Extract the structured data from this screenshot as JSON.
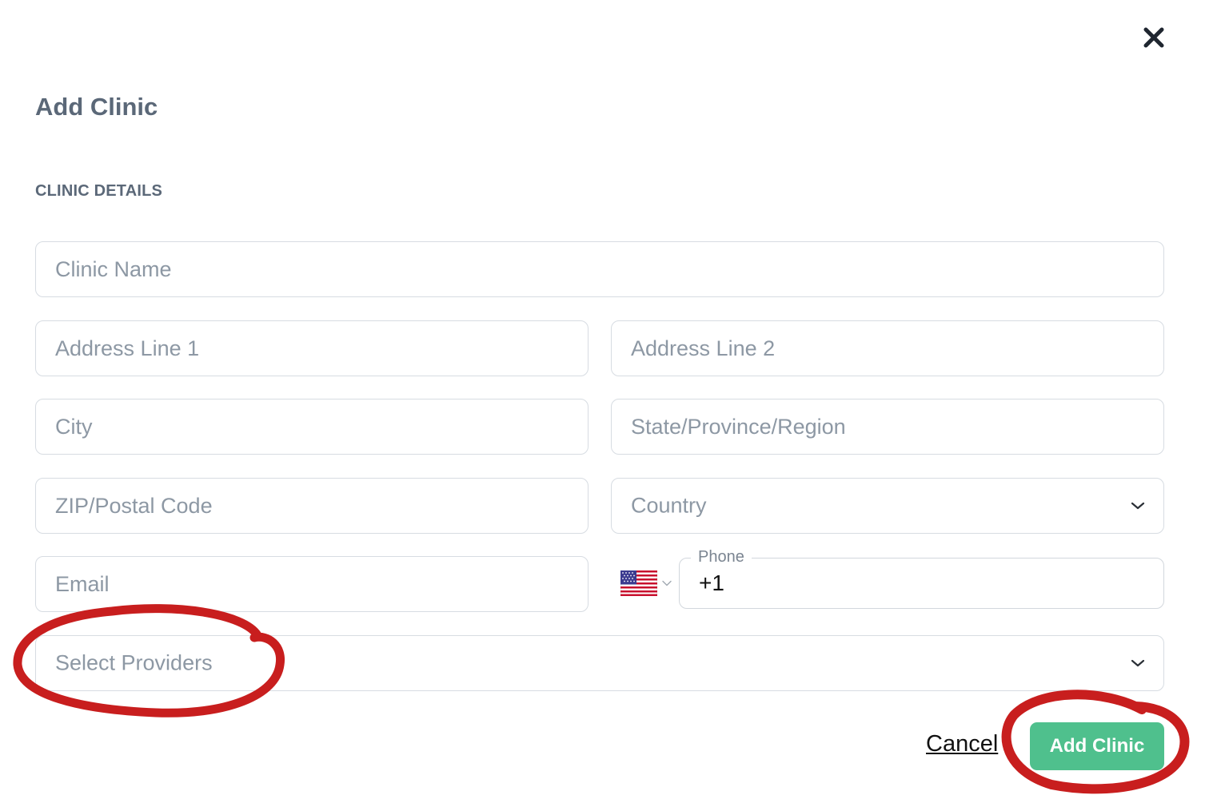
{
  "dialog": {
    "title": "Add Clinic",
    "section_label": "CLINIC DETAILS"
  },
  "form": {
    "clinic_name": {
      "placeholder": "Clinic Name",
      "value": ""
    },
    "address_line_1": {
      "placeholder": "Address Line 1",
      "value": ""
    },
    "address_line_2": {
      "placeholder": "Address Line 2",
      "value": ""
    },
    "city": {
      "placeholder": "City",
      "value": ""
    },
    "state": {
      "placeholder": "State/Province/Region",
      "value": ""
    },
    "zip": {
      "placeholder": "ZIP/Postal Code",
      "value": ""
    },
    "country": {
      "placeholder": "Country",
      "selected": ""
    },
    "email": {
      "placeholder": "Email",
      "value": ""
    },
    "phone": {
      "label": "Phone",
      "value": "+1",
      "country_flag": "us-flag-icon"
    },
    "providers": {
      "placeholder": "Select Providers"
    }
  },
  "actions": {
    "cancel_label": "Cancel",
    "submit_label": "Add Clinic"
  },
  "colors": {
    "primary_button": "#4fc08d",
    "heading_text": "#5b6878",
    "placeholder_text": "#8d98a4",
    "field_border": "#d7dce2",
    "annotation_marker": "#c81e1e"
  },
  "icons": {
    "close": "close-icon",
    "dropdown": "chevron-down-icon"
  }
}
